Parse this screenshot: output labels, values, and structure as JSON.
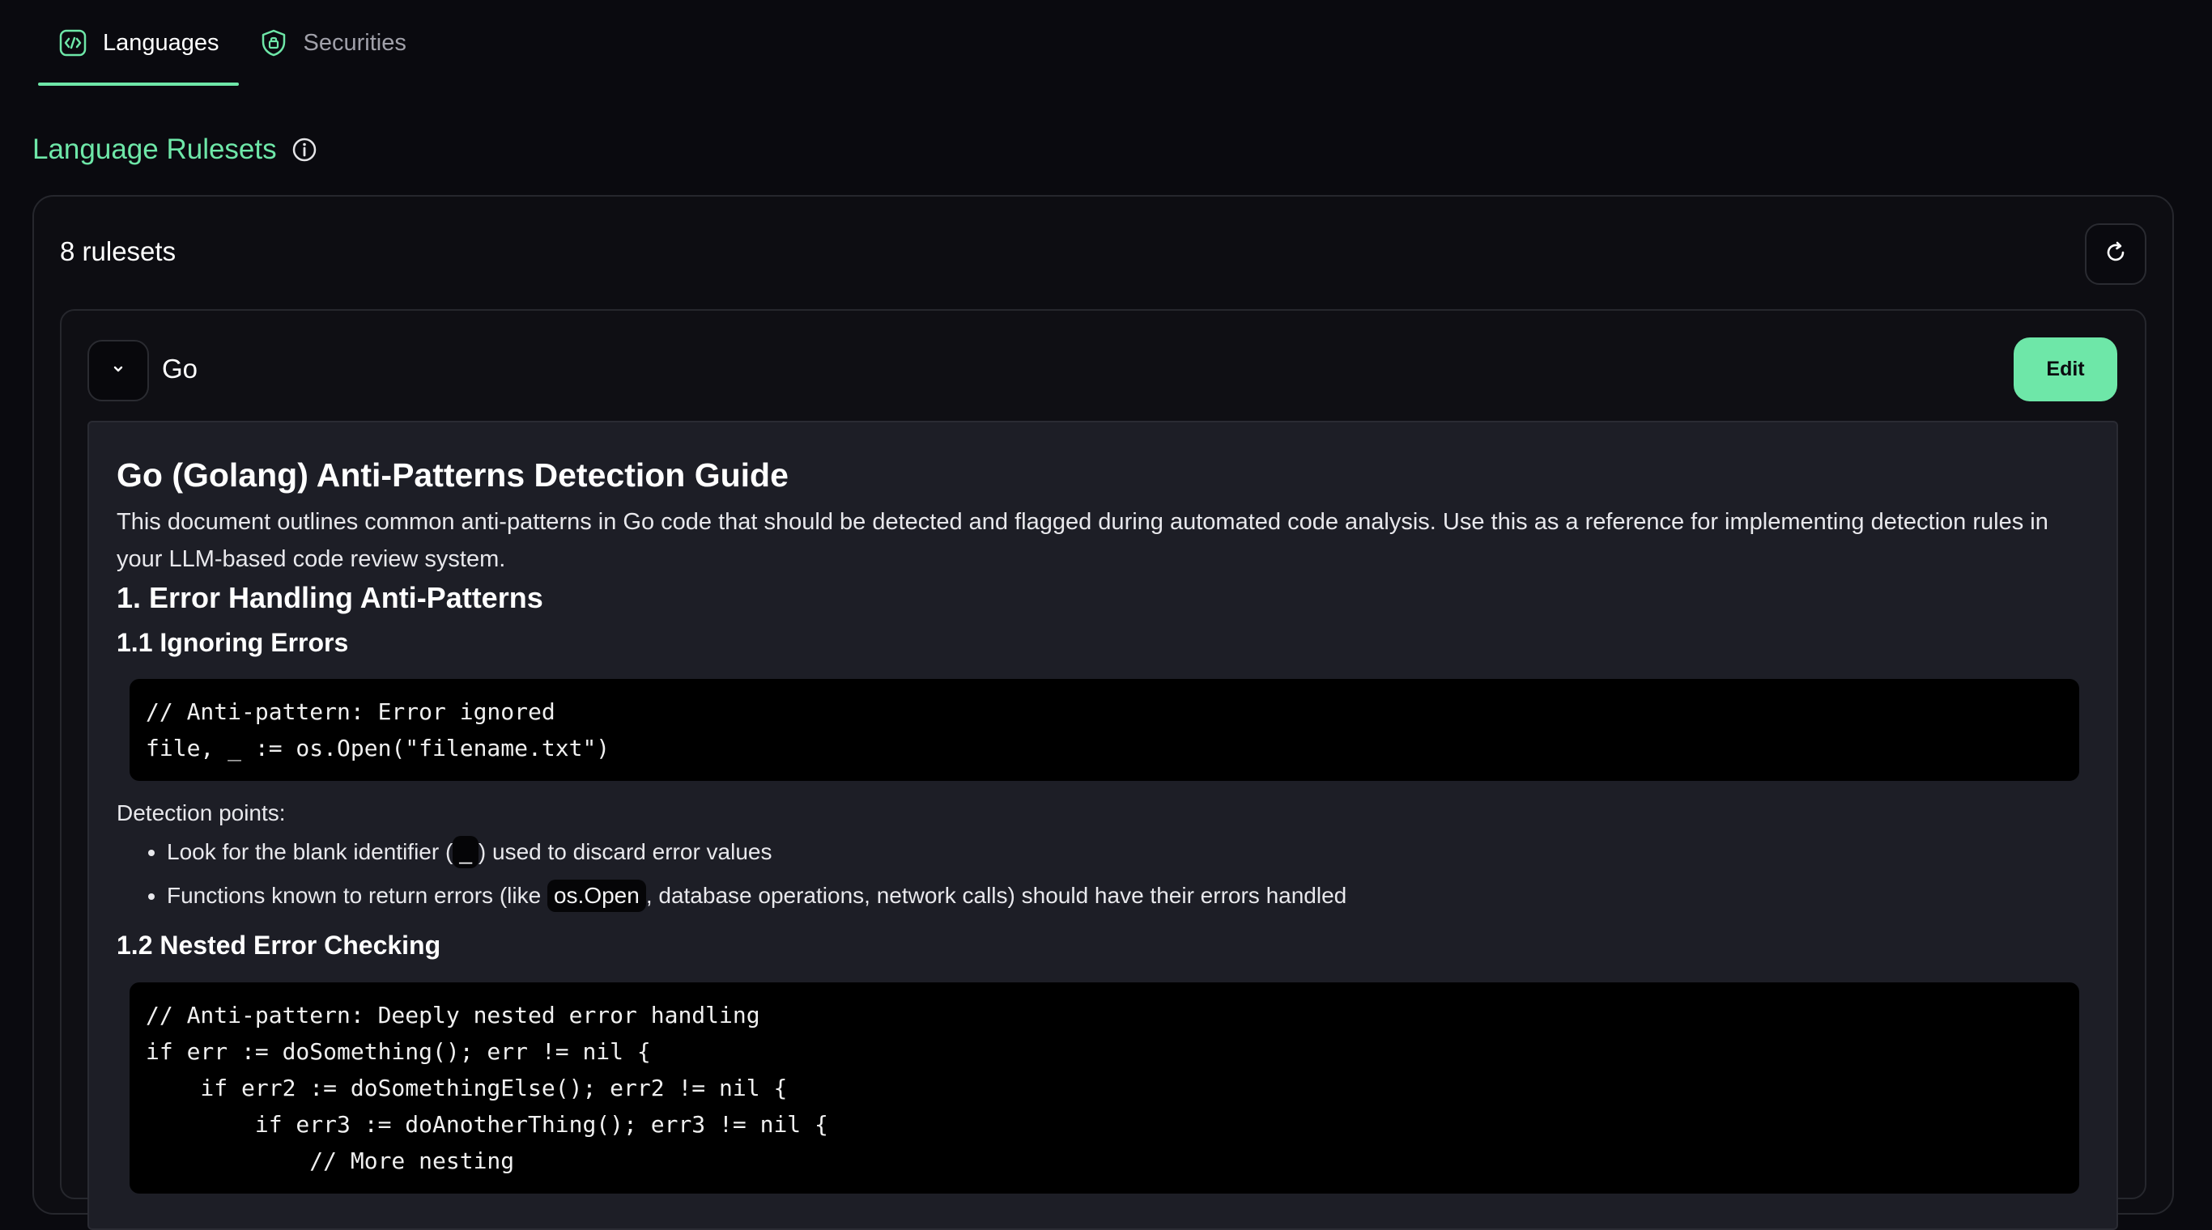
{
  "tabs": [
    {
      "label": "Languages",
      "icon": "code-icon",
      "active": true
    },
    {
      "label": "Securities",
      "icon": "shield-lock-icon",
      "active": false
    }
  ],
  "section": {
    "title": "Language Rulesets",
    "info_icon": "info-icon"
  },
  "rulesets": {
    "count_label": "8 rulesets",
    "refresh_icon": "refresh-icon"
  },
  "ruleset": {
    "name": "Go",
    "edit_label": "Edit",
    "toggle_icon": "chevron-down-icon"
  },
  "doc": {
    "title": "Go (Golang) Anti-Patterns Detection Guide",
    "intro": "This document outlines common anti-patterns in Go code that should be detected and flagged during automated code analysis. Use this as a reference for implementing detection rules in your LLM-based code review system.",
    "section1_title": "1. Error Handling Anti-Patterns",
    "sub1_title": "1.1 Ignoring Errors",
    "code1": "// Anti-pattern: Error ignored\nfile, _ := os.Open(\"filename.txt\")",
    "detection_label": "Detection points:",
    "bullet1_pre": "Look for the blank identifier (",
    "bullet1_code": "_",
    "bullet1_post": ") used to discard error values",
    "bullet2_pre": "Functions known to return errors (like ",
    "bullet2_code": "os.Open",
    "bullet2_post": ", database operations, network calls) should have their errors handled",
    "sub2_title": "1.2 Nested Error Checking",
    "code2": "// Anti-pattern: Deeply nested error handling\nif err := doSomething(); err != nil {\n    if err2 := doSomethingElse(); err2 != nil {\n        if err3 := doAnotherThing(); err3 != nil {\n            // More nesting"
  },
  "colors": {
    "accent": "#6ee7a8",
    "background": "#0a0a0f",
    "panel": "#1d1e26"
  }
}
